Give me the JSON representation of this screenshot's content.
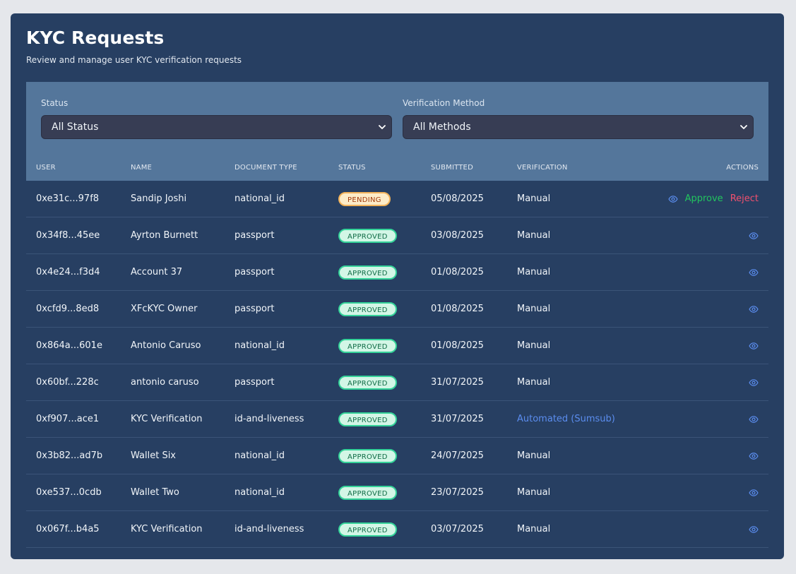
{
  "page": {
    "title": "KYC Requests",
    "subtitle": "Review and manage user KYC verification requests"
  },
  "filters": {
    "status": {
      "label": "Status",
      "selected": "All Status"
    },
    "method": {
      "label": "Verification Method",
      "selected": "All Methods"
    }
  },
  "table": {
    "headers": {
      "user": "USER",
      "name": "NAME",
      "document_type": "DOCUMENT TYPE",
      "status": "STATUS",
      "submitted": "SUBMITTED",
      "verification": "VERIFICATION",
      "actions": "ACTIONS"
    },
    "action_labels": {
      "approve": "Approve",
      "reject": "Reject"
    },
    "rows": [
      {
        "user": "0xe31c...97f8",
        "name": "Sandip Joshi",
        "document_type": "national_id",
        "status": "PENDING",
        "submitted": "05/08/2025",
        "verification": "Manual"
      },
      {
        "user": "0x34f8...45ee",
        "name": "Ayrton Burnett",
        "document_type": "passport",
        "status": "APPROVED",
        "submitted": "03/08/2025",
        "verification": "Manual"
      },
      {
        "user": "0x4e24...f3d4",
        "name": "Account 37",
        "document_type": "passport",
        "status": "APPROVED",
        "submitted": "01/08/2025",
        "verification": "Manual"
      },
      {
        "user": "0xcfd9...8ed8",
        "name": "XFcKYC Owner",
        "document_type": "passport",
        "status": "APPROVED",
        "submitted": "01/08/2025",
        "verification": "Manual"
      },
      {
        "user": "0x864a...601e",
        "name": "Antonio Caruso",
        "document_type": "national_id",
        "status": "APPROVED",
        "submitted": "01/08/2025",
        "verification": "Manual"
      },
      {
        "user": "0x60bf...228c",
        "name": "antonio caruso",
        "document_type": "passport",
        "status": "APPROVED",
        "submitted": "31/07/2025",
        "verification": "Manual"
      },
      {
        "user": "0xf907...ace1",
        "name": "KYC Verification",
        "document_type": "id-and-liveness",
        "status": "APPROVED",
        "submitted": "31/07/2025",
        "verification": "Automated (Sumsub)"
      },
      {
        "user": "0x3b82...ad7b",
        "name": "Wallet Six",
        "document_type": "national_id",
        "status": "APPROVED",
        "submitted": "24/07/2025",
        "verification": "Manual"
      },
      {
        "user": "0xe537...0cdb",
        "name": "Wallet Two",
        "document_type": "national_id",
        "status": "APPROVED",
        "submitted": "23/07/2025",
        "verification": "Manual"
      },
      {
        "user": "0x067f...b4a5",
        "name": "KYC Verification",
        "document_type": "id-and-liveness",
        "status": "APPROVED",
        "submitted": "03/07/2025",
        "verification": "Manual"
      }
    ]
  },
  "icons": {
    "view": "eye-icon",
    "dropdown": "chevron-down-icon"
  },
  "colors": {
    "card_bg": "#273f62",
    "filter_bg": "#54769b",
    "approve": "#22c55e",
    "reject": "#f0506e",
    "automated": "#5b8def",
    "approved_badge_bg": "#d3f6e6",
    "pending_badge_bg": "#fdecc8"
  }
}
